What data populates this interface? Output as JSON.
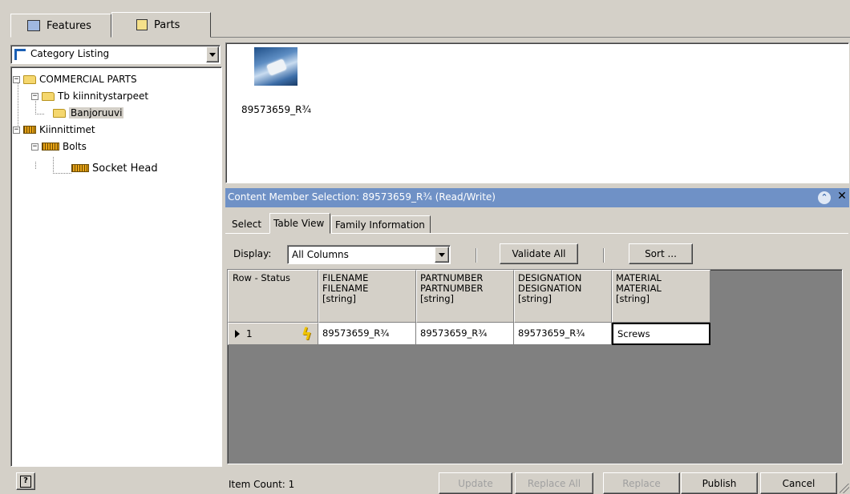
{
  "tabs": {
    "features": "Features",
    "parts": "Parts"
  },
  "category_select": {
    "value": "Category Listing"
  },
  "tree": {
    "commercial_parts": "COMMERCIAL PARTS",
    "tb_kiinnitystarpeet": "Tb kiinnitystarpeet",
    "banjoruuvi": "Banjoruuvi",
    "kiinnittimet": "Kiinnittimet",
    "bolts": "Bolts",
    "socket_head": "Socket Head"
  },
  "preview": {
    "label": "89573659_R¾"
  },
  "content_panel": {
    "title": "Content Member Selection:  89573659_R¾ (Read/Write)",
    "tabs": [
      "Select",
      "Table View",
      "Family Information"
    ]
  },
  "toolbar": {
    "display_label": "Display:",
    "display_value": "All Columns",
    "validate_label": "Validate All",
    "sort_label": "Sort ..."
  },
  "table": {
    "row_status_header": "Row - Status",
    "columns": [
      {
        "l1": "FILENAME",
        "l2": "FILENAME",
        "l3": "[string]"
      },
      {
        "l1": "PARTNUMBER",
        "l2": "PARTNUMBER",
        "l3": "[string]"
      },
      {
        "l1": "DESIGNATION",
        "l2": "DESIGNATION",
        "l3": "[string]"
      },
      {
        "l1": "MATERIAL",
        "l2": "MATERIAL",
        "l3": "[string]"
      }
    ],
    "rows": [
      {
        "num": "1",
        "cells": [
          "89573659_R¾",
          "89573659_R¾",
          "89573659_R¾",
          "Screws"
        ]
      }
    ]
  },
  "footer": {
    "item_count": "Item Count: 1",
    "update": "Update",
    "replace_all": "Replace All",
    "replace": "Replace",
    "publish": "Publish",
    "cancel": "Cancel"
  }
}
